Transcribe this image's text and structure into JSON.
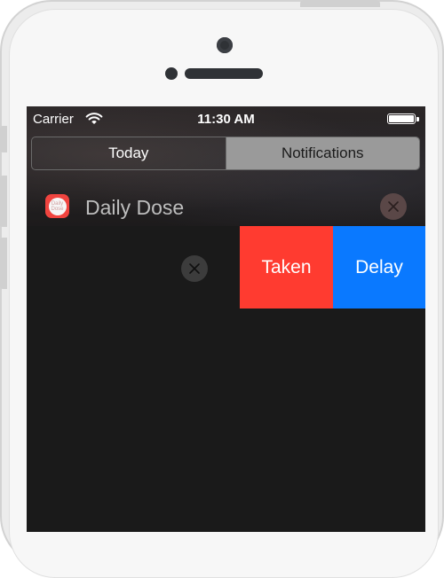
{
  "status_bar": {
    "carrier": "Carrier",
    "time": "11:30 AM",
    "wifi_icon": "wifi-icon",
    "battery_icon": "battery-icon"
  },
  "segmented_control": {
    "tabs": [
      {
        "label": "Today",
        "selected": true
      },
      {
        "label": "Notifications",
        "selected": false
      }
    ]
  },
  "notification": {
    "app_icon": "daily-dose-app-icon",
    "app_icon_text": "Daily Dose",
    "app_name": "Daily Dose",
    "header_close_icon": "close-icon",
    "row_close_icon": "close-icon",
    "actions": [
      {
        "label": "Taken",
        "color": "#ff3b30"
      },
      {
        "label": "Delay",
        "color": "#0a79ff"
      }
    ]
  }
}
